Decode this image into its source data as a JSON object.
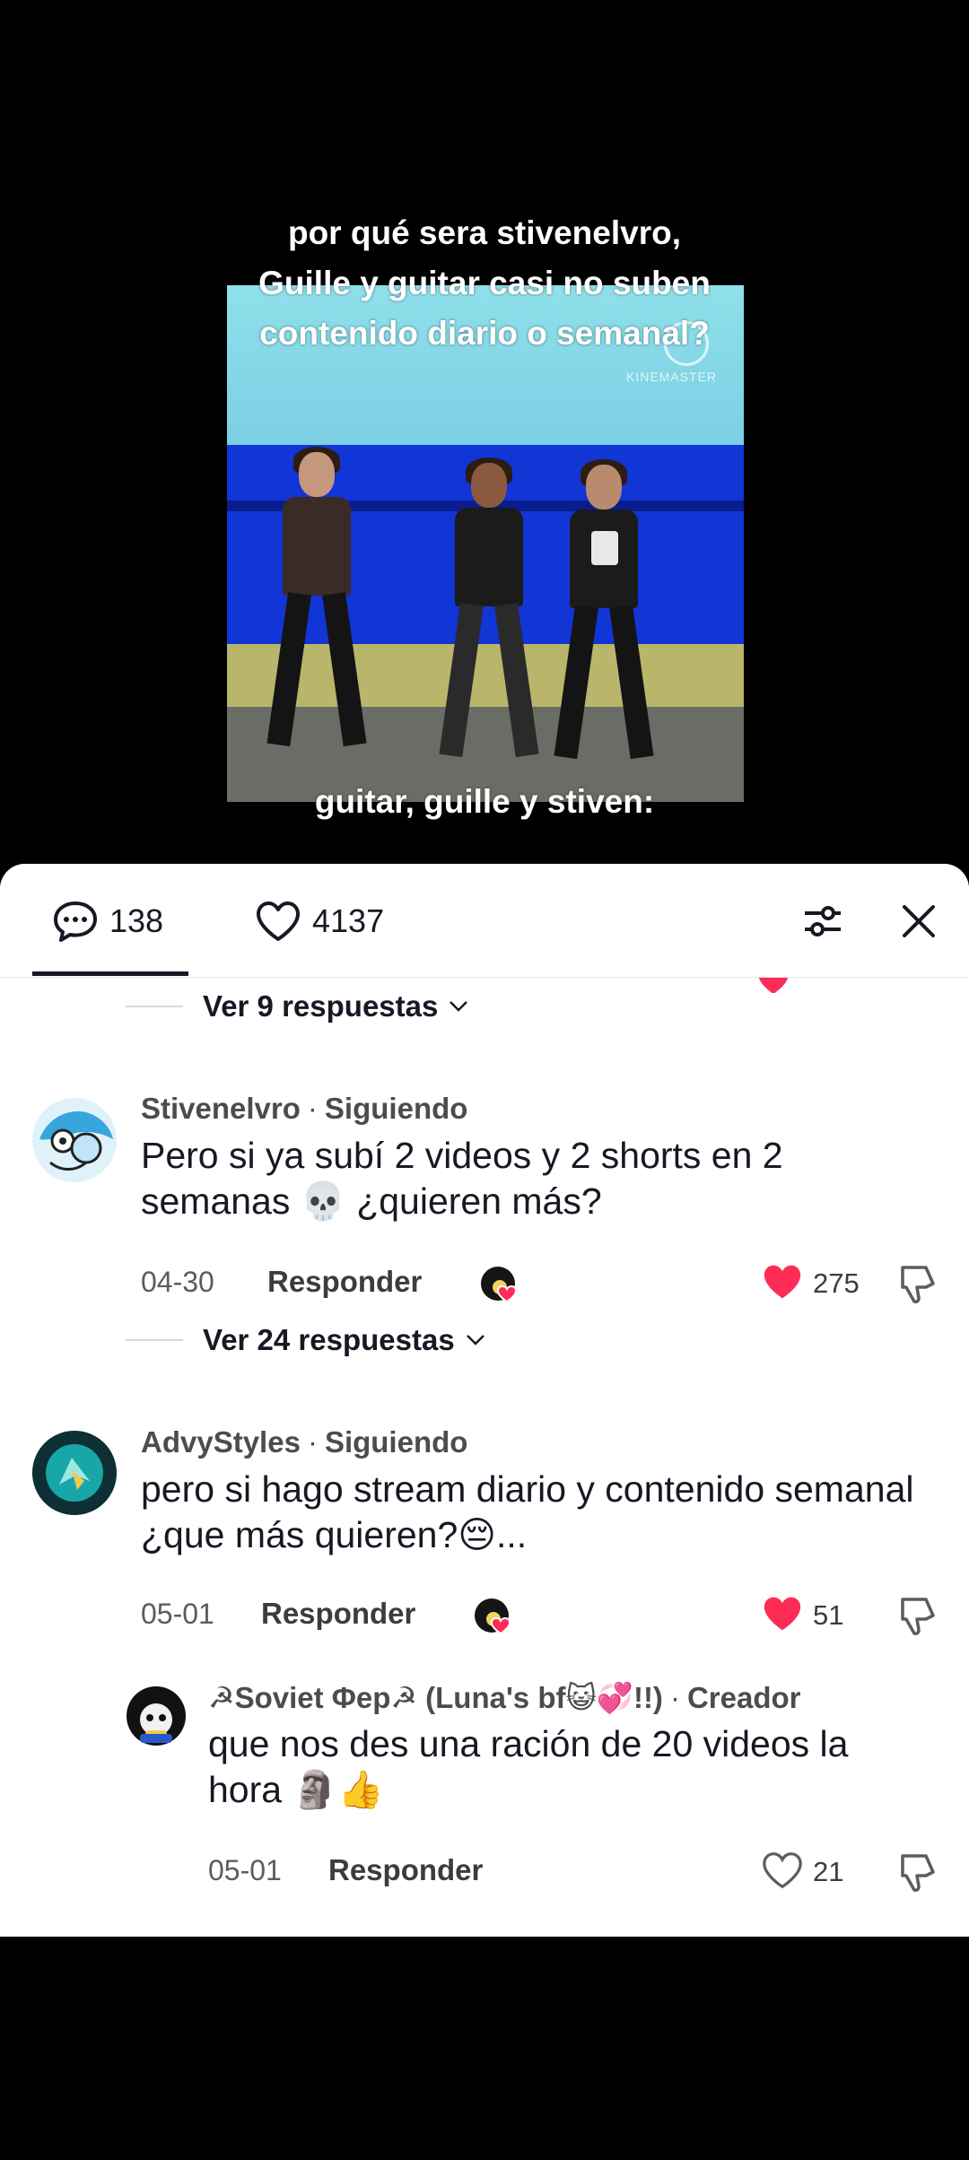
{
  "video": {
    "caption_top_lines": [
      "por qué sera stivenelvro,",
      "Guille y guitar casi no suben",
      "contenido diario o semanal?"
    ],
    "caption_bottom": "guitar, guille y stiven:",
    "watermark": "KINEMASTER"
  },
  "panel": {
    "comment_count": "138",
    "like_count": "4137"
  },
  "replies_toggle_1": "Ver 9 respuestas",
  "comments": [
    {
      "author": "Stivenelvro",
      "badge": "Siguiendo",
      "text": "Pero si ya subí 2 videos y 2 shorts en 2 semanas 💀 ¿quieren más?",
      "date": "04-30",
      "reply_label": "Responder",
      "likes": "275",
      "liked": true
    },
    {
      "author": "AdvyStyles",
      "badge": "Siguiendo",
      "text": "pero si hago stream diario y contenido semanal ¿que más quieren?😔...",
      "date": "05-01",
      "reply_label": "Responder",
      "likes": "51",
      "liked": true
    },
    {
      "author": "☭Soviet Φep☭ (Luna's bf😺💞!!)",
      "badge": "Creador",
      "text": "que nos des una ración de 20 videos la hora 🗿👍",
      "date": "05-01",
      "reply_label": "Responder",
      "likes": "21",
      "liked": false
    }
  ],
  "replies_toggle_2": "Ver 24 respuestas",
  "colors": {
    "like_red": "#fe2c55",
    "text": "#161823",
    "muted": "#5c5c5c"
  }
}
